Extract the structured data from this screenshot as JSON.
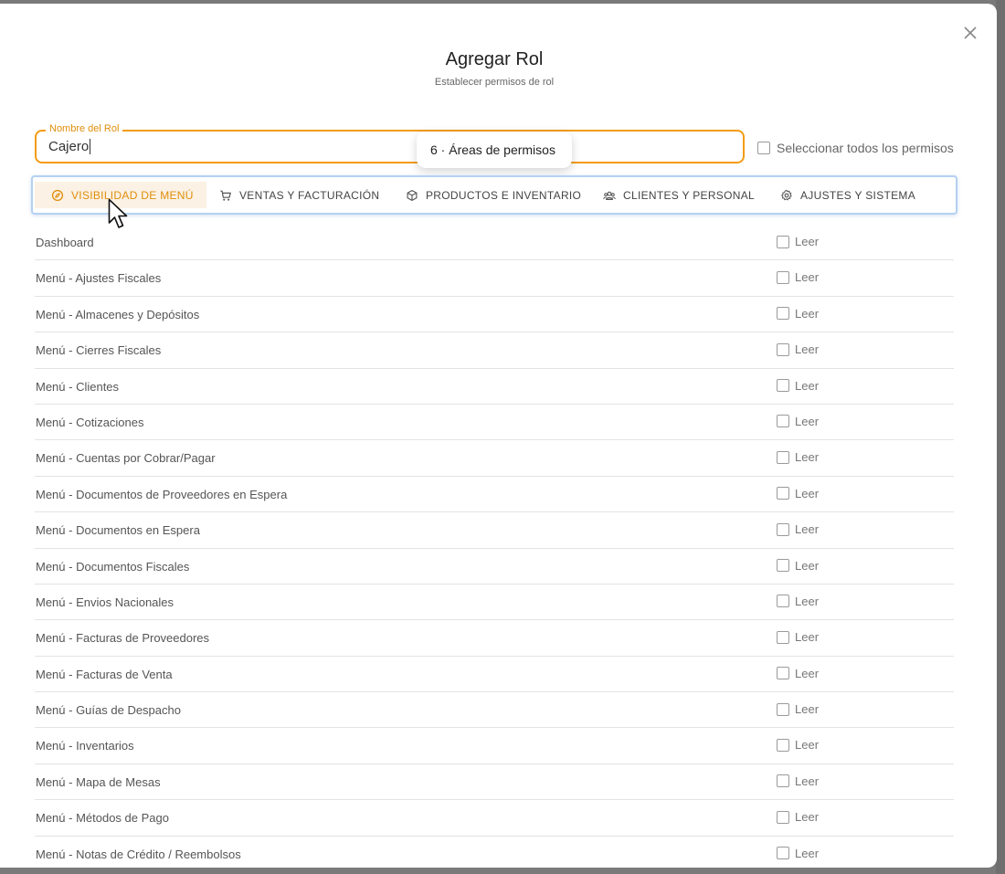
{
  "modal": {
    "title": "Agregar Rol",
    "subtitle": "Establecer permisos de rol",
    "close_icon": "close-icon"
  },
  "role_name": {
    "label": "Nombre del Rol",
    "value": "Cajero"
  },
  "tooltip": {
    "text": "6 · Áreas de permisos"
  },
  "select_all": {
    "label": "Seleccionar todos los permisos",
    "checked": false
  },
  "tabs": [
    {
      "label": "VISIBILIDAD DE MENÚ",
      "icon": "compass-icon",
      "active": true
    },
    {
      "label": "VENTAS Y FACTURACIÓN",
      "icon": "cart-icon",
      "active": false
    },
    {
      "label": "PRODUCTOS E INVENTARIO",
      "icon": "box-icon",
      "active": false
    },
    {
      "label": "CLIENTES Y PERSONAL",
      "icon": "users-icon",
      "active": false
    },
    {
      "label": "AJUSTES Y SISTEMA",
      "icon": "gear-icon",
      "active": false
    }
  ],
  "colors": {
    "accent": "#f39c12",
    "tab_border": "#b5d0f2"
  },
  "permission_label": "Leer",
  "permissions": [
    {
      "name": "Dashboard",
      "read": false
    },
    {
      "name": "Menú - Ajustes Fiscales",
      "read": false
    },
    {
      "name": "Menú - Almacenes y Depósitos",
      "read": false
    },
    {
      "name": "Menú - Cierres Fiscales",
      "read": false
    },
    {
      "name": "Menú - Clientes",
      "read": false
    },
    {
      "name": "Menú - Cotizaciones",
      "read": false
    },
    {
      "name": "Menú - Cuentas por Cobrar/Pagar",
      "read": false
    },
    {
      "name": "Menú - Documentos de Proveedores en Espera",
      "read": false
    },
    {
      "name": "Menú - Documentos en Espera",
      "read": false
    },
    {
      "name": "Menú - Documentos Fiscales",
      "read": false
    },
    {
      "name": "Menú - Envios Nacionales",
      "read": false
    },
    {
      "name": "Menú - Facturas de Proveedores",
      "read": false
    },
    {
      "name": "Menú - Facturas de Venta",
      "read": false
    },
    {
      "name": "Menú - Guías de Despacho",
      "read": false
    },
    {
      "name": "Menú - Inventarios",
      "read": false
    },
    {
      "name": "Menú - Mapa de Mesas",
      "read": false
    },
    {
      "name": "Menú - Métodos de Pago",
      "read": false
    },
    {
      "name": "Menú - Notas de Crédito / Reembolsos",
      "read": false
    }
  ]
}
